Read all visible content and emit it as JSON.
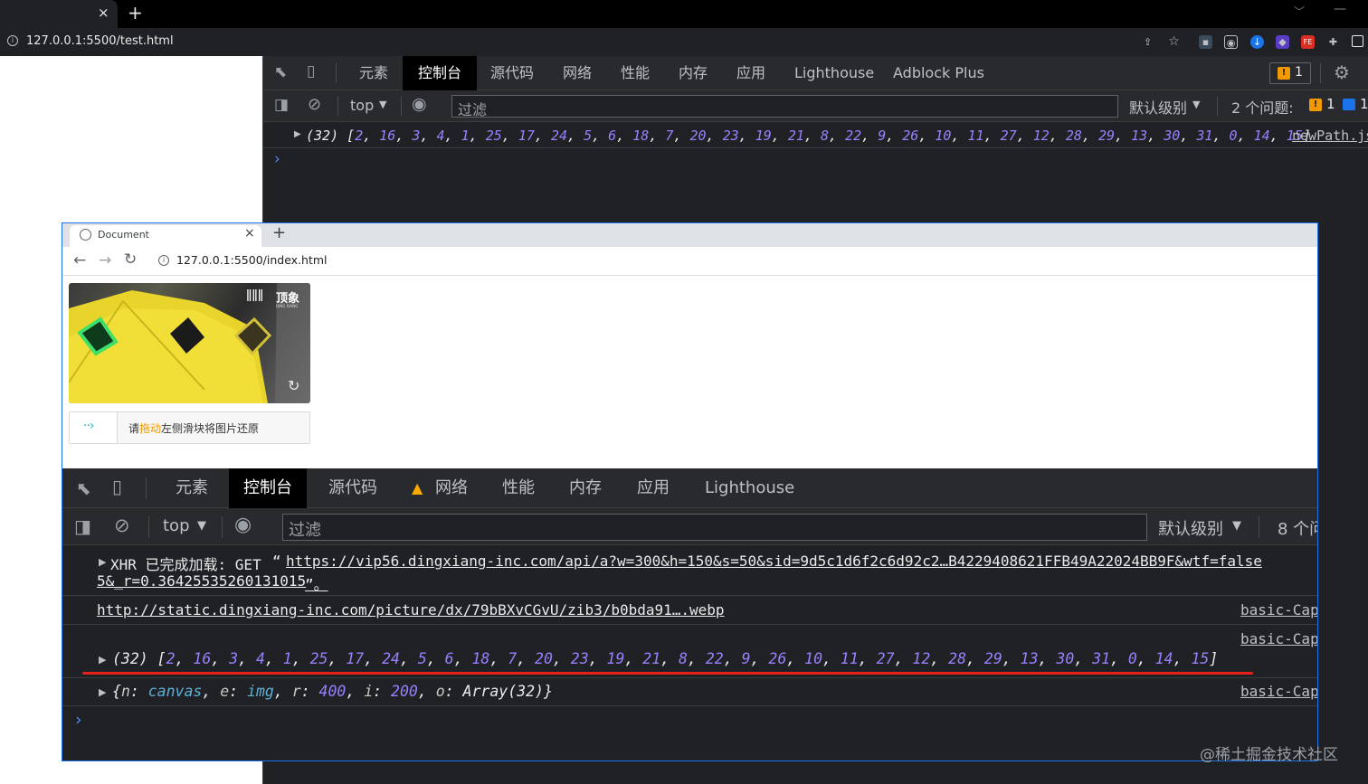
{
  "outer": {
    "tab_close": "×",
    "new_tab": "+",
    "url": "127.0.0.1:5500/test.html",
    "devtools": {
      "tabs": [
        "元素",
        "控制台",
        "源代码",
        "网络",
        "性能",
        "内存",
        "应用",
        "Lighthouse",
        "Adblock Plus"
      ],
      "issue_badge": "1",
      "context": "top",
      "filter_placeholder": "过滤",
      "level": "默认级别",
      "issues_label": "2 个问题:",
      "issues_warn": "1",
      "issues_info": "1",
      "log_prefix": "(32)",
      "array": [
        2,
        16,
        3,
        4,
        1,
        25,
        17,
        24,
        5,
        6,
        18,
        7,
        20,
        23,
        19,
        21,
        8,
        22,
        9,
        26,
        10,
        11,
        27,
        12,
        28,
        29,
        13,
        30,
        31,
        0,
        14,
        15
      ],
      "source_link": "newPath.js",
      "prompt": "›"
    }
  },
  "inner": {
    "tab_title": "Document",
    "tab_close": "×",
    "new_tab": "+",
    "url": "127.0.0.1:5500/index.html",
    "captcha": {
      "brand": "顶象",
      "brand_sub": "DING XIANG",
      "slider_hint_pre": "请",
      "slider_hint_em": "拖动",
      "slider_hint_post": "左侧滑块将图片还原",
      "arrow": "··›"
    },
    "devtools": {
      "tabs": [
        "元素",
        "控制台",
        "源代码",
        "网络",
        "性能",
        "内存",
        "应用",
        "Lighthouse"
      ],
      "context": "top",
      "filter_placeholder": "过滤",
      "level": "默认级别",
      "issues_label": "8 个问",
      "xhr_label": "XHR 已完成加载: GET",
      "xhr_open_quote": "“",
      "xhr_url": "https://vip56.dingxiang-inc.com/api/a?w=300&h=150&s=50&sid=9d5c1d6f2c6d92c2…B4229408621FFB49A22024BB9F&wtf=false",
      "xhr_url_line2": "5&_r=0.36425535260131015",
      "xhr_close_quote": "”。",
      "picture_url": "http://static.dingxiang-inc.com/picture/dx/79bBXvCGvU/zib3/b0bda91….webp",
      "source_link": "basic-Cap",
      "log_prefix": "(32)",
      "array": [
        2,
        16,
        3,
        4,
        1,
        25,
        17,
        24,
        5,
        6,
        18,
        7,
        20,
        23,
        19,
        21,
        8,
        22,
        9,
        26,
        10,
        11,
        27,
        12,
        28,
        29,
        13,
        30,
        31,
        0,
        14,
        15
      ],
      "obj_open": "{",
      "obj_n_key": "n",
      "obj_n_val": "canvas",
      "obj_e_key": "e",
      "obj_e_val": "img",
      "obj_r_key": "r",
      "obj_r_val": "400",
      "obj_i_key": "i",
      "obj_i_val": "200",
      "obj_o_key": "o",
      "obj_o_val": "Array(32)",
      "obj_close": "}",
      "prompt": "›"
    }
  },
  "watermark": "@稀土掘金技术社区",
  "colors": {
    "array_number": "#9980ff",
    "underline_red": "#e8201c",
    "accent_blue": "#1a73e8",
    "warning": "#f29900",
    "slider_arrow": "#1fb5c1"
  }
}
